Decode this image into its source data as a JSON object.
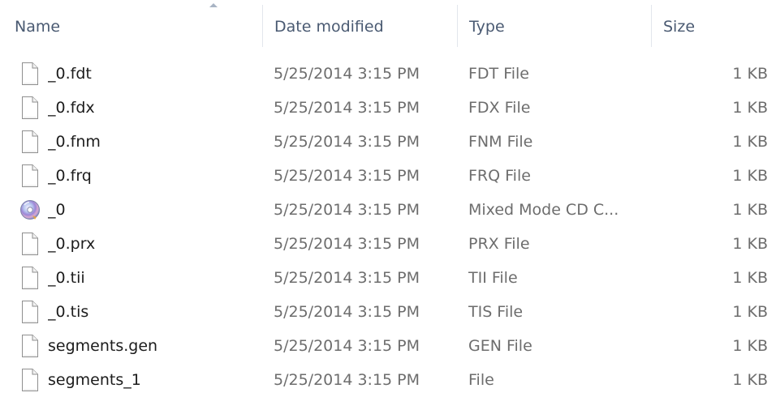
{
  "columns": {
    "name": "Name",
    "date": "Date modified",
    "type": "Type",
    "size": "Size"
  },
  "files": [
    {
      "name": "_0.fdt",
      "date": "5/25/2014 3:15 PM",
      "type": "FDT File",
      "size": "1 KB",
      "icon": "document-icon"
    },
    {
      "name": "_0.fdx",
      "date": "5/25/2014 3:15 PM",
      "type": "FDX File",
      "size": "1 KB",
      "icon": "document-icon"
    },
    {
      "name": "_0.fnm",
      "date": "5/25/2014 3:15 PM",
      "type": "FNM File",
      "size": "1 KB",
      "icon": "document-icon"
    },
    {
      "name": "_0.frq",
      "date": "5/25/2014 3:15 PM",
      "type": "FRQ File",
      "size": "1 KB",
      "icon": "document-icon"
    },
    {
      "name": "_0",
      "date": "5/25/2014 3:15 PM",
      "type": "Mixed Mode CD C...",
      "size": "1 KB",
      "icon": "cd-disc-icon"
    },
    {
      "name": "_0.prx",
      "date": "5/25/2014 3:15 PM",
      "type": "PRX File",
      "size": "1 KB",
      "icon": "document-icon"
    },
    {
      "name": "_0.tii",
      "date": "5/25/2014 3:15 PM",
      "type": "TII File",
      "size": "1 KB",
      "icon": "document-icon"
    },
    {
      "name": "_0.tis",
      "date": "5/25/2014 3:15 PM",
      "type": "TIS File",
      "size": "1 KB",
      "icon": "document-icon"
    },
    {
      "name": "segments.gen",
      "date": "5/25/2014 3:15 PM",
      "type": "GEN File",
      "size": "1 KB",
      "icon": "document-icon"
    },
    {
      "name": "segments_1",
      "date": "5/25/2014 3:15 PM",
      "type": "File",
      "size": "1 KB",
      "icon": "document-icon"
    }
  ],
  "colors": {
    "header_text": "#4a5a72",
    "name_text": "#1c1c1c",
    "detail_text": "#6d6d6d",
    "separator": "#e2e6ec"
  }
}
